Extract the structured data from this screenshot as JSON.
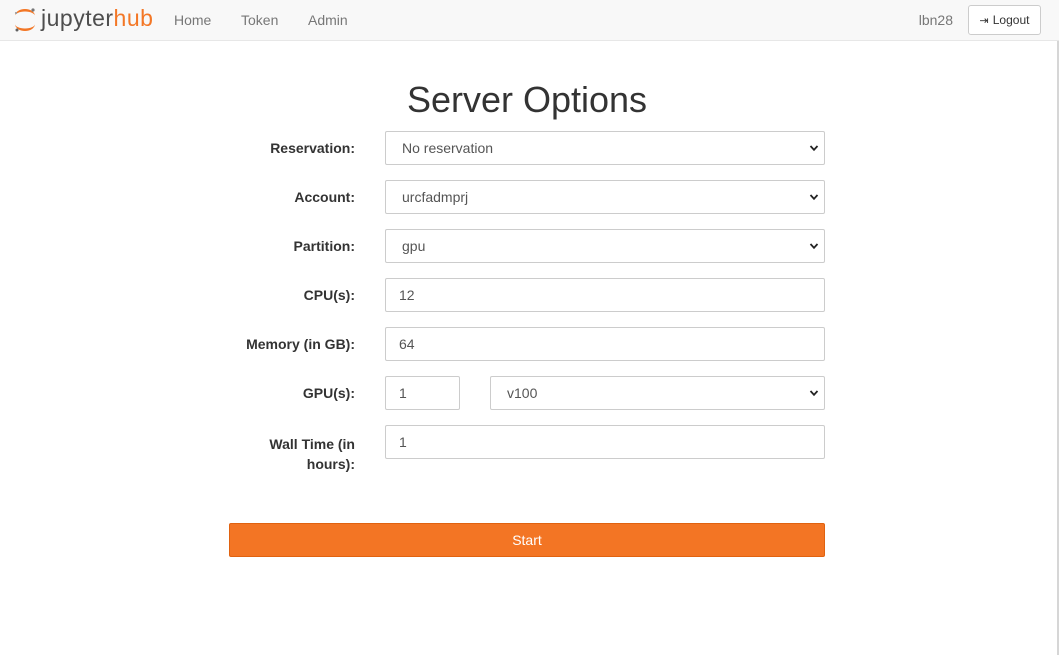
{
  "brand": {
    "part1": "jupyter",
    "part2": "hub",
    "accent": "#f37726"
  },
  "nav": {
    "home": "Home",
    "token": "Token",
    "admin": "Admin",
    "user": "lbn28",
    "logout": "Logout",
    "logout_icon": "sign-out-icon"
  },
  "page": {
    "title": "Server Options"
  },
  "form": {
    "reservation": {
      "label": "Reservation:",
      "value": "No reservation"
    },
    "account": {
      "label": "Account:",
      "value": "urcfadmprj"
    },
    "partition": {
      "label": "Partition:",
      "value": "gpu"
    },
    "cpus": {
      "label": "CPU(s):",
      "value": "12"
    },
    "memory": {
      "label": "Memory (in GB):",
      "value": "64"
    },
    "gpus": {
      "label": "GPU(s):",
      "count": "1",
      "type": "v100"
    },
    "walltime": {
      "label_line1": "Wall Time (in",
      "label_line2": "hours):",
      "value": "1"
    }
  },
  "start_button": {
    "label": "Start",
    "color": "#f37524"
  }
}
